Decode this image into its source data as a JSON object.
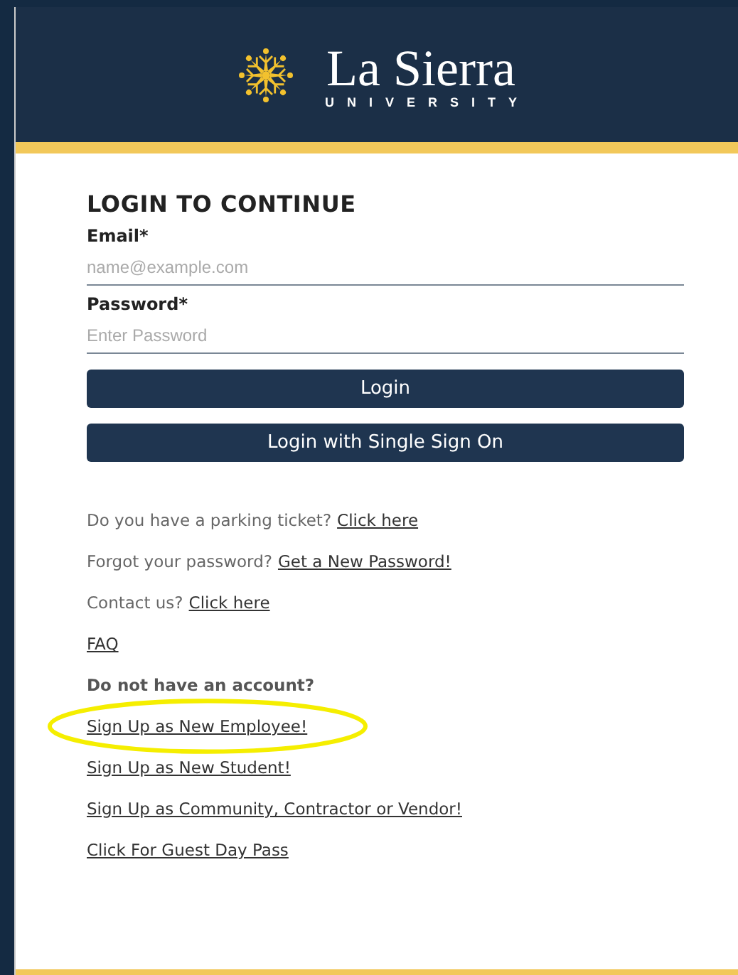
{
  "header": {
    "logo_name": "La Sierra",
    "logo_subtitle": "UNIVERSITY"
  },
  "login": {
    "title": "LOGIN TO CONTINUE",
    "fields": [
      {
        "label": "Email*",
        "placeholder": "name@example.com"
      },
      {
        "label": "Password*",
        "placeholder": "Enter Password"
      }
    ],
    "buttons": [
      "Login",
      "Login with Single Sign On"
    ]
  },
  "links": [
    {
      "kind": "link",
      "text": "Do you have a parking ticket?",
      "link": "Click here",
      "highlighted": false
    },
    {
      "kind": "link",
      "text": "Forgot your password?",
      "link": "Get a New Password!",
      "highlighted": false
    },
    {
      "kind": "link",
      "text": "Contact us?",
      "link": "Click here",
      "highlighted": false
    },
    {
      "kind": "link",
      "link": "FAQ",
      "highlighted": false
    },
    {
      "kind": "heading",
      "text": "Do not have an account?"
    },
    {
      "kind": "link",
      "link": "Sign Up as New Employee!",
      "highlighted": true
    },
    {
      "kind": "link",
      "link": "Sign Up as New Student!",
      "highlighted": false
    },
    {
      "kind": "link",
      "link": "Sign Up as Community, Contractor or Vendor!",
      "highlighted": false
    },
    {
      "kind": "link",
      "link": "Click For Guest Day Pass",
      "highlighted": false
    }
  ]
}
